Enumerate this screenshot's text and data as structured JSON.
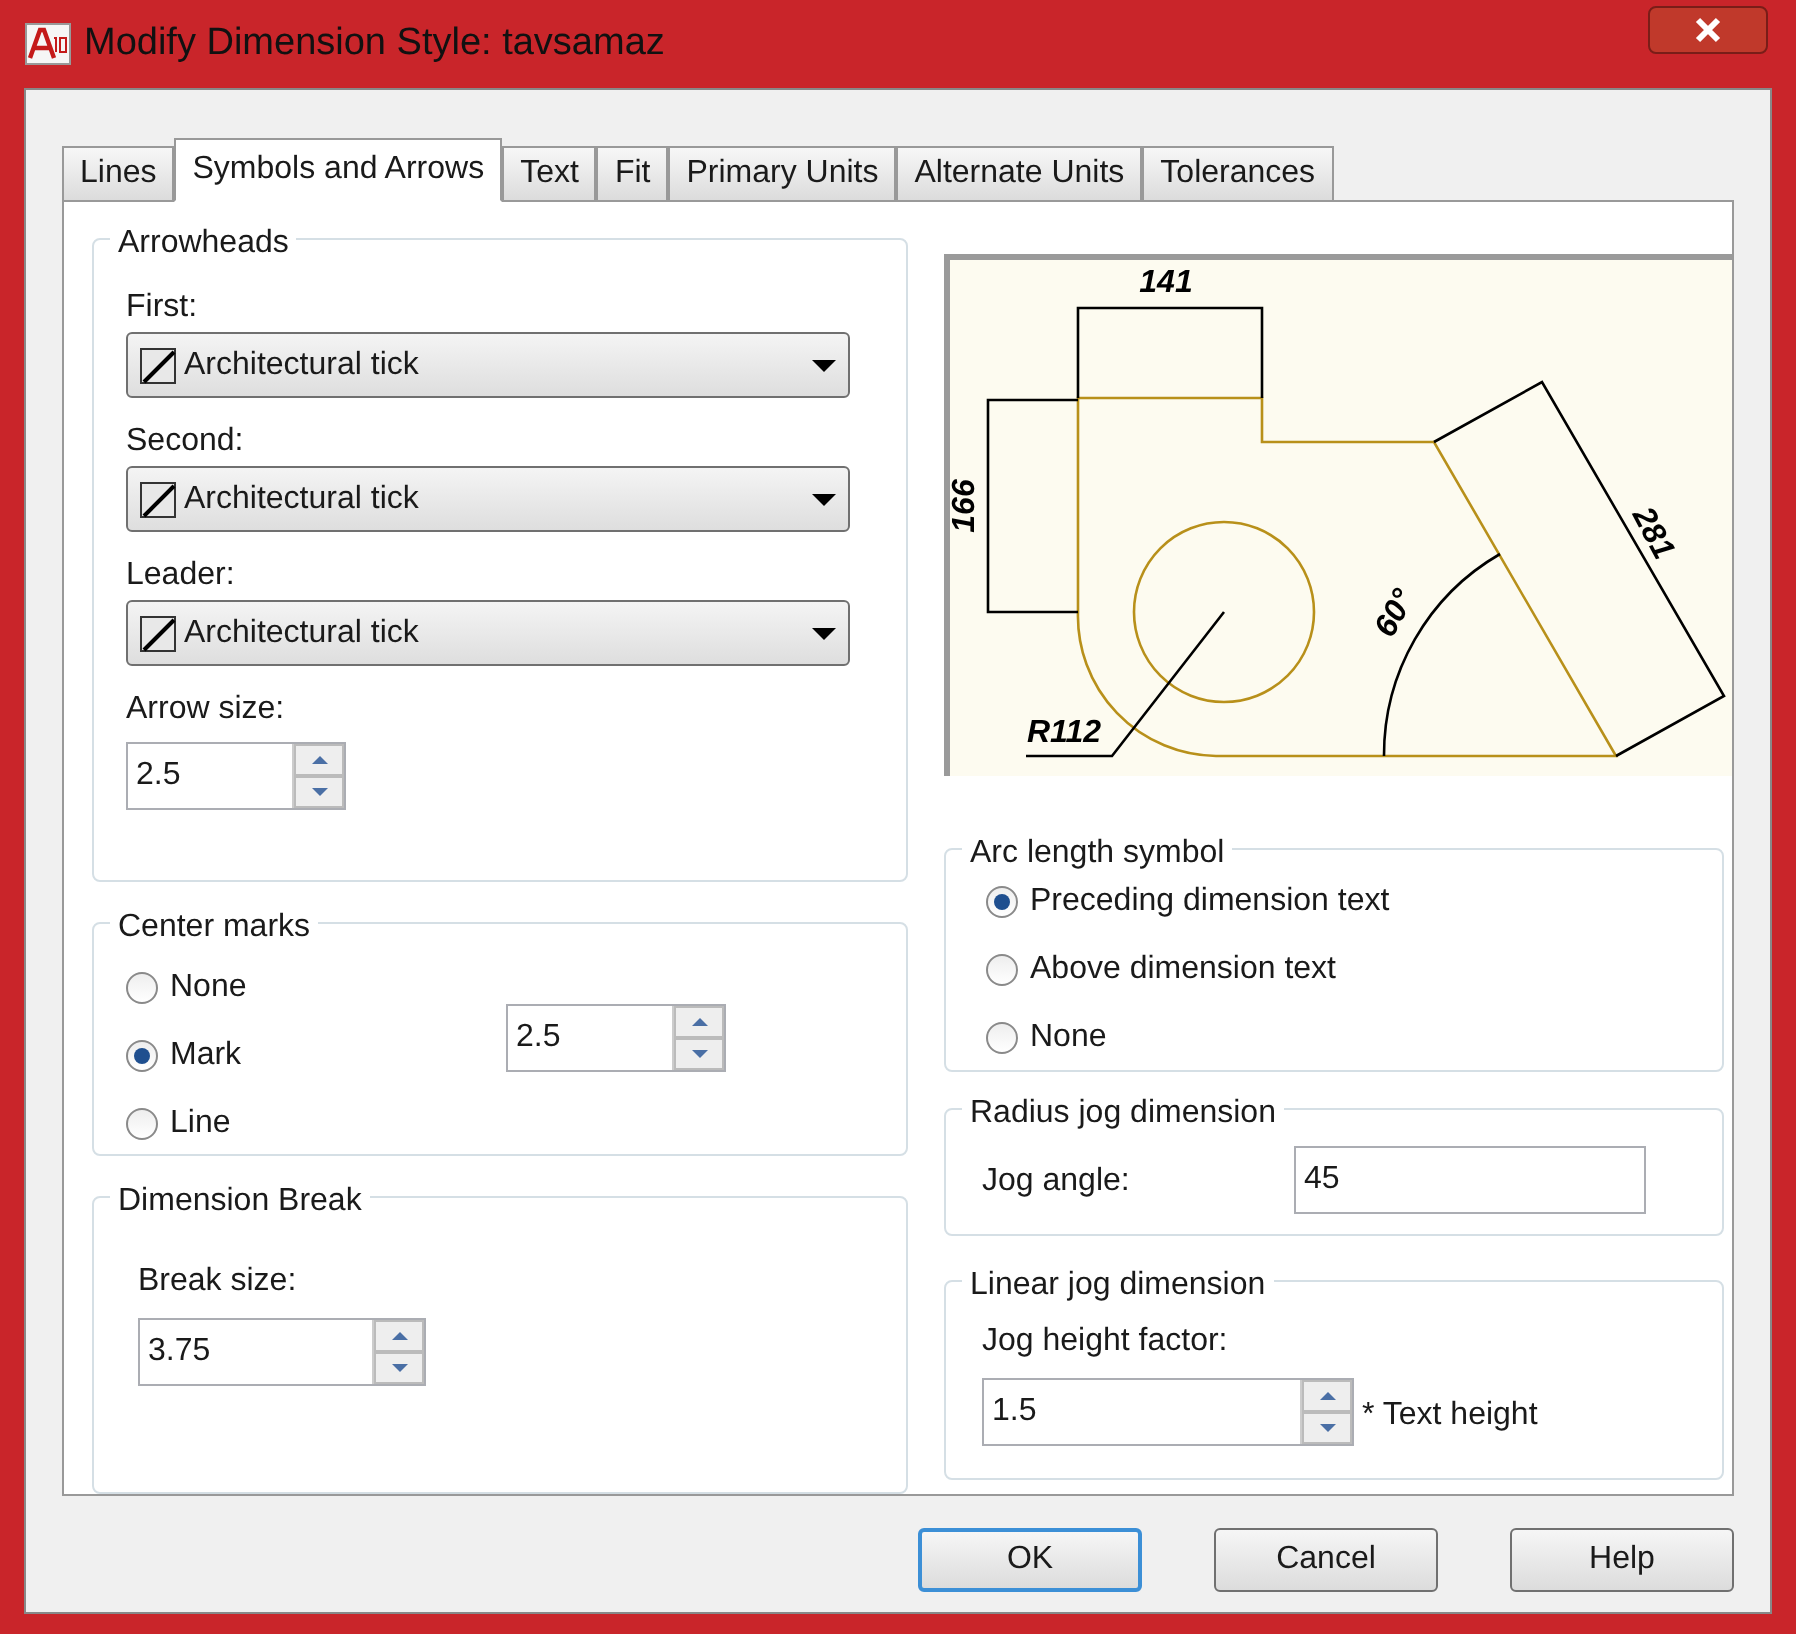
{
  "window": {
    "title": "Modify Dimension Style: tavsamaz"
  },
  "tabs": [
    {
      "label": "Lines",
      "selected": false
    },
    {
      "label": "Symbols and Arrows",
      "selected": true
    },
    {
      "label": "Text",
      "selected": false
    },
    {
      "label": "Fit",
      "selected": false
    },
    {
      "label": "Primary Units",
      "selected": false
    },
    {
      "label": "Alternate Units",
      "selected": false
    },
    {
      "label": "Tolerances",
      "selected": false
    }
  ],
  "arrowheads": {
    "title": "Arrowheads",
    "dropdowns": [
      {
        "label": "First:",
        "value": "Architectural tick"
      },
      {
        "label": "Second:",
        "value": "Architectural tick"
      },
      {
        "label": "Leader:",
        "value": "Architectural tick"
      }
    ],
    "arrow_size": {
      "label": "Arrow size:",
      "value": "2.5"
    }
  },
  "center_marks": {
    "title": "Center marks",
    "options": [
      {
        "label": "None",
        "selected": false
      },
      {
        "label": "Mark",
        "selected": true
      },
      {
        "label": "Line",
        "selected": false
      }
    ],
    "size": "2.5"
  },
  "dimension_break": {
    "title": "Dimension Break",
    "label": "Break size:",
    "value": "3.75"
  },
  "preview": {
    "labels": [
      "141",
      "166",
      "281",
      "60°",
      "R112"
    ]
  },
  "arc_length_symbol": {
    "title": "Arc length symbol",
    "options": [
      {
        "label": "Preceding dimension text",
        "selected": true
      },
      {
        "label": "Above dimension text",
        "selected": false
      },
      {
        "label": "None",
        "selected": false
      }
    ]
  },
  "radius_jog": {
    "title": "Radius jog dimension",
    "label": "Jog angle:",
    "value": "45"
  },
  "linear_jog": {
    "title": "Linear jog dimension",
    "label": "Jog height factor:",
    "value": "1.5",
    "suffix": "* Text height"
  },
  "buttons": [
    {
      "label": "OK",
      "focused": true
    },
    {
      "label": "Cancel",
      "focused": false
    },
    {
      "label": "Help",
      "focused": false
    }
  ]
}
